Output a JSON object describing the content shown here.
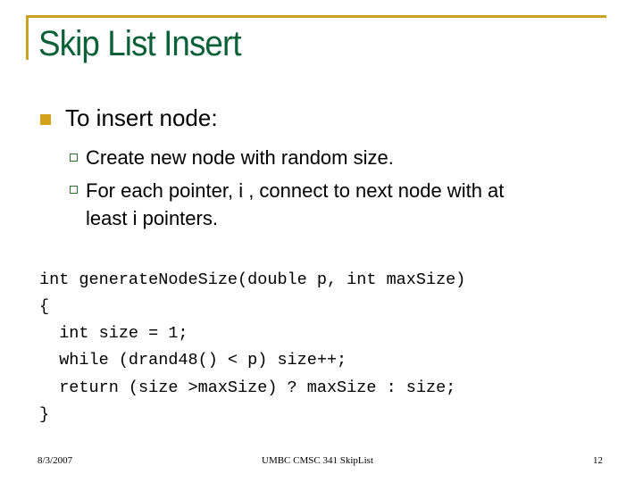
{
  "slide": {
    "title": "Skip List Insert",
    "bullets": [
      {
        "text": "To insert node:",
        "sub_bullets": [
          "Create new node with random size.",
          "For each pointer, i , connect to next node with at",
          "least i pointers."
        ]
      }
    ],
    "code_lines": [
      "int generateNodeSize(double p, int maxSize)",
      "{",
      "  int size = 1;",
      "  while (drand48() < p) size++;",
      "  return (size >maxSize) ? maxSize : size;",
      "}"
    ],
    "footer": {
      "date": "8/3/2007",
      "center": "UMBC CMSC 341 SkipList",
      "page_number": "12"
    },
    "colors": {
      "accent_gold": "#C9A227",
      "title_green": "#0B6137",
      "bullet_gold": "#D1A21A",
      "sub_bullet_green": "#2C6E2C"
    }
  }
}
